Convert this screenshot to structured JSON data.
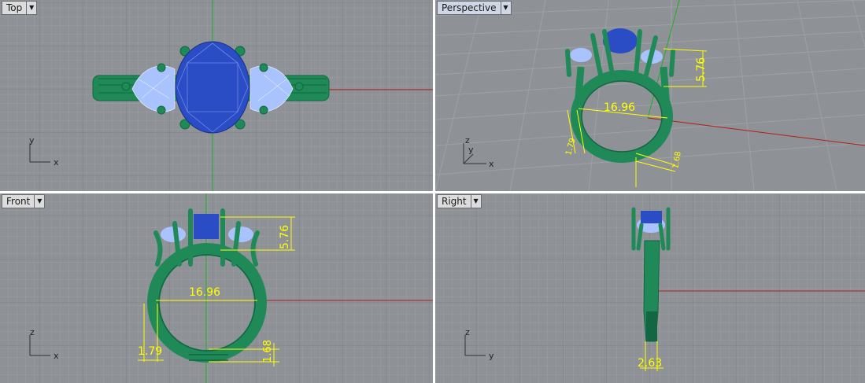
{
  "viewports": {
    "top": {
      "title": "Top",
      "axis_h": "x",
      "axis_v": "y"
    },
    "perspective": {
      "title": "Perspective",
      "axis_h": "x",
      "axis_v": "y",
      "axis_up": "z"
    },
    "front": {
      "title": "Front",
      "axis_h": "x",
      "axis_v": "z"
    },
    "right": {
      "title": "Right",
      "axis_h": "y",
      "axis_v": "z"
    }
  },
  "dropdown_glyph": "▼",
  "dimensions": {
    "inner_diameter": "16.96",
    "setting_height": "5.76",
    "band_width": "1.79",
    "band_thickness": "1.68",
    "band_depth": "2.63"
  },
  "colors": {
    "viewport_bg": "#8e9296",
    "grid_minor": "#9b9fa3",
    "grid_major": "#7e8286",
    "metal": "#1f8a58",
    "metal_dark": "#126641",
    "center_stone": "#2a4cc4",
    "side_stone": "#a9c3ff",
    "dimension": "#ffff00",
    "x_axis": "#b0201a",
    "z_axis": "#1fb01f"
  }
}
